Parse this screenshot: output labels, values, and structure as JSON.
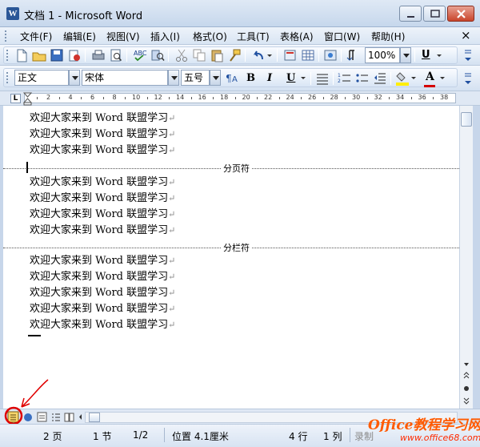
{
  "window": {
    "title": "文档 1 - Microsoft Word",
    "app_icon": "W"
  },
  "menu": {
    "items": [
      "文件(F)",
      "编辑(E)",
      "视图(V)",
      "插入(I)",
      "格式(O)",
      "工具(T)",
      "表格(A)",
      "窗口(W)",
      "帮助(H)"
    ],
    "close_glyph": "×"
  },
  "toolbar_standard": {
    "zoom": "100%",
    "underline_label": "U"
  },
  "toolbar_format": {
    "style": "正文",
    "font": "宋体",
    "size": "五号",
    "bold": "B",
    "italic": "I",
    "underline": "U",
    "font_color_label": "A"
  },
  "ruler": {
    "numbers": [
      "2",
      "4",
      "6",
      "8",
      "10",
      "12",
      "14",
      "16",
      "18",
      "20",
      "22",
      "24",
      "26",
      "28",
      "30",
      "32",
      "34",
      "36",
      "38"
    ],
    "tab_marker": "L"
  },
  "document": {
    "line_text": "欢迎大家来到 Word 联盟学习",
    "para_mark": "↵",
    "page_break_label": "分页符",
    "column_break_label": "分栏符"
  },
  "status": {
    "page": "2 页",
    "section": "1 节",
    "pages": "1/2",
    "position": "位置 4.1厘米",
    "row": "4 行",
    "column": "1 列",
    "record": "录制"
  },
  "watermark": {
    "brand": "Office教程学习网",
    "url": "www.office68.com"
  },
  "colors": {
    "highlight_red": "#e00000",
    "font_color_red": "#d40000",
    "highlighter_yellow": "#ffee00"
  }
}
